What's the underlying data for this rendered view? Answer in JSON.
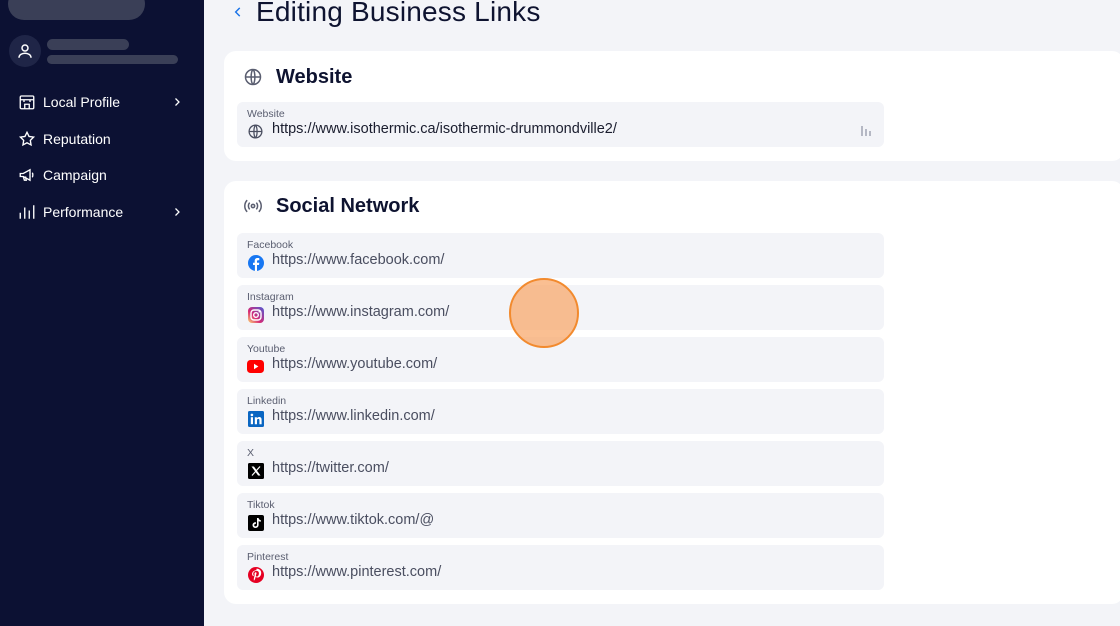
{
  "sidebar": {
    "items": [
      {
        "label": "Local Profile",
        "icon": "store-icon",
        "has_submenu": true
      },
      {
        "label": "Reputation",
        "icon": "star-icon",
        "has_submenu": false
      },
      {
        "label": "Campaign",
        "icon": "megaphone-icon",
        "has_submenu": false
      },
      {
        "label": "Performance",
        "icon": "bar-chart-icon",
        "has_submenu": true
      }
    ]
  },
  "page": {
    "title": "Editing Business Links"
  },
  "website_section": {
    "title": "Website",
    "field": {
      "label": "Website",
      "value": "https://www.isothermic.ca/isothermic-drummondville2/",
      "icon": "globe-icon"
    }
  },
  "social_section": {
    "title": "Social Network",
    "fields": [
      {
        "label": "Facebook",
        "value": "https://www.facebook.com/",
        "icon": "facebook-icon"
      },
      {
        "label": "Instagram",
        "value": "https://www.instagram.com/",
        "icon": "instagram-icon"
      },
      {
        "label": "Youtube",
        "value": "https://www.youtube.com/",
        "icon": "youtube-icon"
      },
      {
        "label": "Linkedin",
        "value": "https://www.linkedin.com/",
        "icon": "linkedin-icon"
      },
      {
        "label": "X",
        "value": "https://twitter.com/",
        "icon": "x-icon"
      },
      {
        "label": "Tiktok",
        "value": "https://www.tiktok.com/@",
        "icon": "tiktok-icon"
      },
      {
        "label": "Pinterest",
        "value": "https://www.pinterest.com/",
        "icon": "pinterest-icon"
      }
    ]
  },
  "colors": {
    "sidebar_bg": "#0c1133",
    "page_bg": "#f3f4f8",
    "accent": "#1a73e8",
    "cursor": "#f28a2e"
  }
}
